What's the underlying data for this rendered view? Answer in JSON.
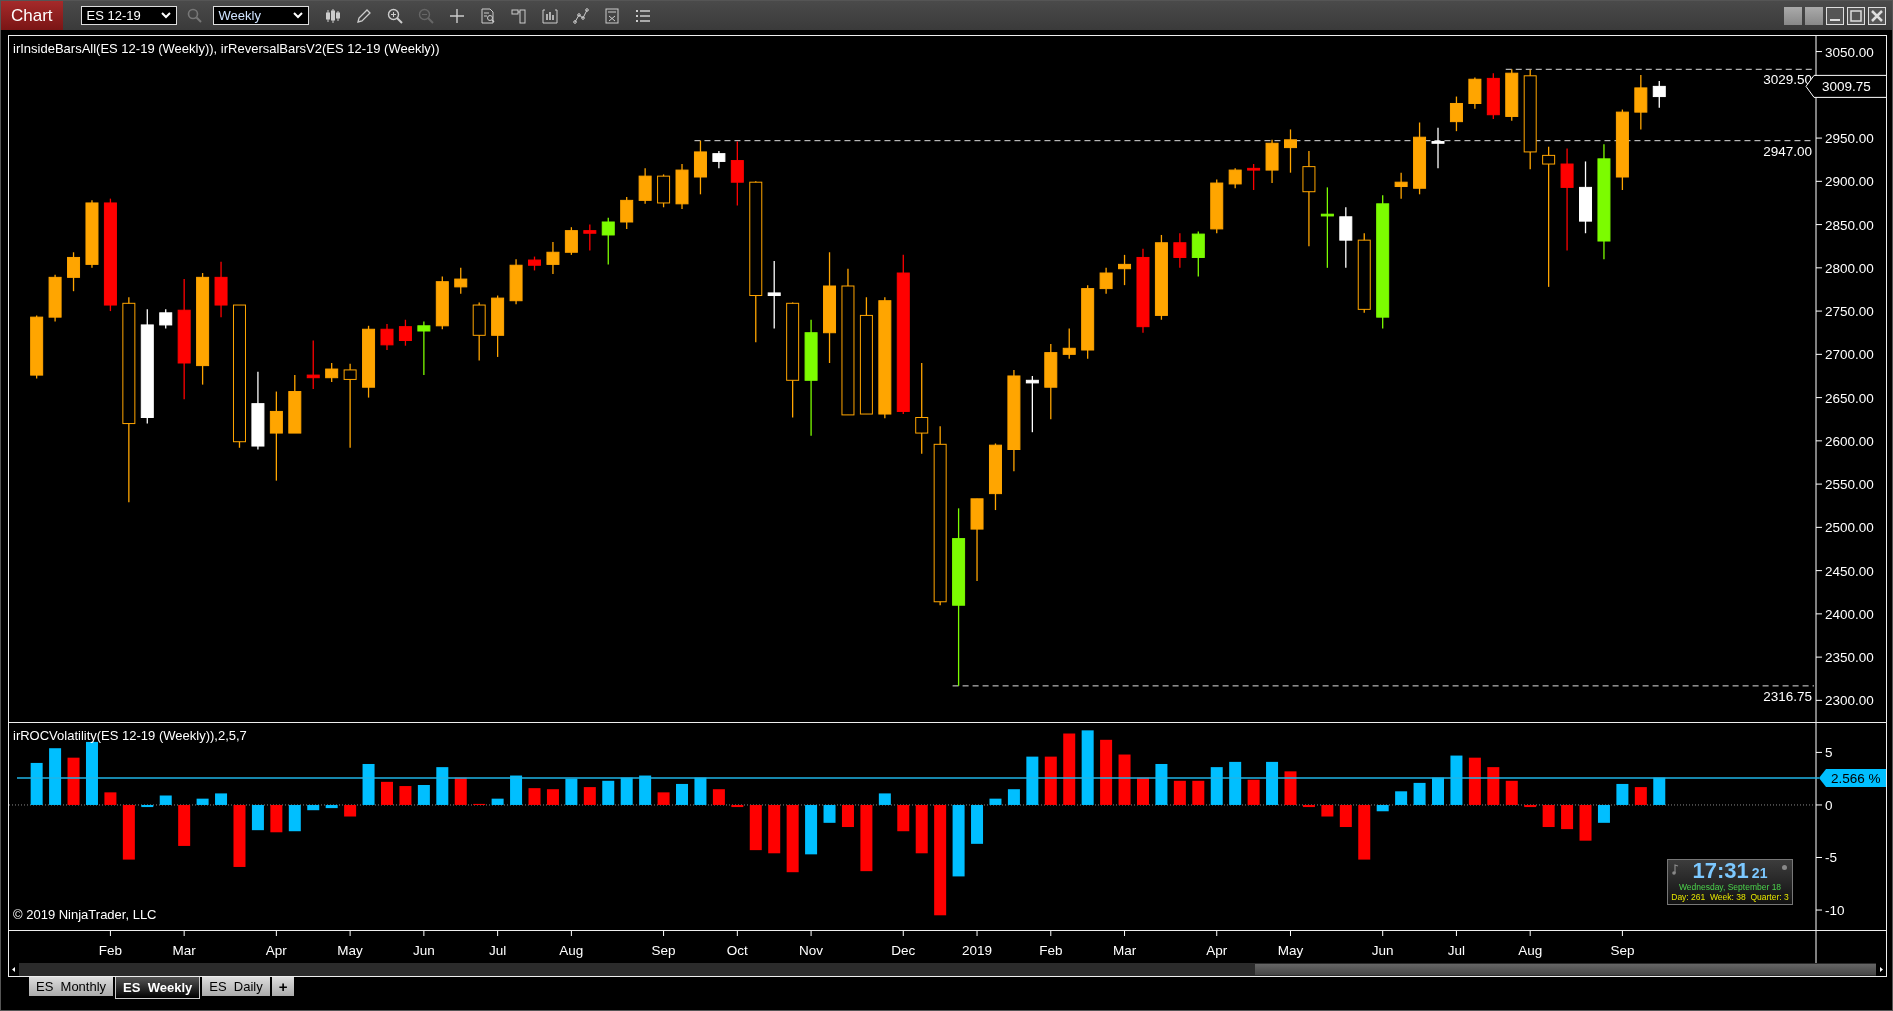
{
  "toolbar": {
    "title": "Chart",
    "instrument": "ES 12-19",
    "interval": "Weekly"
  },
  "price_chart": {
    "title": "irInsideBarsAll(ES 12-19 (Weekly)), irReversalBarsV2(ES 12-19 (Weekly))",
    "chart_data": {
      "type": "candlestick",
      "ylim": [
        2275,
        3068
      ],
      "categories": [
        null,
        null,
        null,
        null,
        null,
        null,
        null,
        null,
        null,
        null,
        null,
        null,
        null,
        null,
        null,
        null,
        null,
        null,
        null,
        null,
        null,
        null,
        null,
        null,
        null,
        null,
        null,
        null,
        null,
        null,
        null,
        null,
        null,
        null,
        null,
        null,
        null,
        null,
        null,
        null,
        null,
        null,
        null,
        null,
        null,
        null,
        null,
        null,
        null,
        null,
        null,
        null,
        null,
        null,
        null,
        null,
        null,
        null,
        null,
        null,
        null,
        null,
        null,
        null,
        null,
        null,
        null,
        null,
        null,
        null,
        null,
        null,
        null,
        null,
        null,
        null,
        null,
        null,
        null,
        null,
        null,
        null,
        null,
        null,
        null,
        null,
        null,
        null,
        null,
        null,
        null,
        null,
        null,
        null,
        null,
        null,
        null,
        null
      ],
      "yticks": [
        {
          "value": 3050,
          "label": "3050.00"
        },
        {
          "value": 2950,
          "label": "2950.00"
        },
        {
          "value": 2900,
          "label": "2900.00"
        },
        {
          "value": 2850,
          "label": "2850.00"
        },
        {
          "value": 2800,
          "label": "2800.00"
        },
        {
          "value": 2750,
          "label": "2750.00"
        },
        {
          "value": 2700,
          "label": "2700.00"
        },
        {
          "value": 2650,
          "label": "2650.00"
        },
        {
          "value": 2600,
          "label": "2600.00"
        },
        {
          "value": 2550,
          "label": "2550.00"
        },
        {
          "value": 2500,
          "label": "2500.00"
        },
        {
          "value": 2450,
          "label": "2450.00"
        },
        {
          "value": 2400,
          "label": "2400.00"
        },
        {
          "value": 2350,
          "label": "2350.00"
        },
        {
          "value": 2300,
          "label": "2300.00"
        }
      ],
      "ohlc": [
        null,
        [
          2676,
          2745,
          2672,
          2743
        ],
        [
          2743,
          2792,
          2738,
          2789
        ],
        [
          2789,
          2818,
          2773,
          2812
        ],
        [
          2804,
          2878,
          2800,
          2875
        ],
        [
          2875,
          2880,
          2750,
          2757
        ],
        [
          2759,
          2766,
          2529,
          2620
        ],
        [
          2627,
          2752,
          2620,
          2734
        ],
        [
          2734,
          2752,
          2730,
          2748
        ],
        [
          2751,
          2787,
          2648,
          2690
        ],
        [
          2687,
          2794,
          2665,
          2789
        ],
        [
          2789,
          2807,
          2743,
          2757
        ],
        [
          2757,
          2757,
          2592,
          2599
        ],
        [
          2594,
          2680,
          2590,
          2643
        ],
        [
          2609,
          2657,
          2554,
          2634
        ],
        [
          2609,
          2676,
          2609,
          2657
        ],
        [
          2676,
          2716,
          2660,
          2673
        ],
        [
          2673,
          2690,
          2668,
          2683
        ],
        [
          2682,
          2689,
          2592,
          2671
        ],
        [
          2662,
          2733,
          2650,
          2729
        ],
        [
          2729,
          2735,
          2705,
          2711
        ],
        [
          2732,
          2740,
          2710,
          2716
        ],
        [
          2727,
          2738,
          2676,
          2733
        ],
        [
          2733,
          2790,
          2729,
          2784
        ],
        [
          2778,
          2800,
          2770,
          2787
        ],
        [
          2757,
          2760,
          2693,
          2722
        ],
        [
          2722,
          2768,
          2697,
          2765
        ],
        [
          2762,
          2810,
          2758,
          2803
        ],
        [
          2809,
          2813,
          2797,
          2803
        ],
        [
          2804,
          2830,
          2793,
          2818
        ],
        [
          2818,
          2847,
          2815,
          2843
        ],
        [
          2843,
          2850,
          2820,
          2840
        ],
        [
          2838,
          2858,
          2804,
          2853
        ],
        [
          2853,
          2882,
          2845,
          2878
        ],
        [
          2878,
          2915,
          2874,
          2906
        ],
        [
          2906,
          2908,
          2870,
          2875
        ],
        [
          2874,
          2920,
          2868,
          2913
        ],
        [
          2905,
          2947,
          2885,
          2934
        ],
        [
          2923,
          2935,
          2915,
          2932
        ],
        [
          2924,
          2946,
          2872,
          2899
        ],
        [
          2899,
          2900,
          2714,
          2768
        ],
        [
          2771,
          2808,
          2730,
          2768
        ],
        [
          2759,
          2760,
          2627,
          2670
        ],
        [
          2670,
          2740,
          2606,
          2725
        ],
        [
          2725,
          2818,
          2690,
          2779
        ],
        [
          2779,
          2799,
          2630,
          2630
        ],
        [
          2745,
          2766,
          2631,
          2631
        ],
        [
          2631,
          2766,
          2626,
          2762
        ],
        [
          2794,
          2815,
          2631,
          2634
        ],
        [
          2627,
          2690,
          2585,
          2609
        ],
        [
          2596,
          2617,
          2410,
          2414
        ],
        [
          2410,
          2522,
          2316.75,
          2487
        ],
        [
          2498,
          2533,
          2438,
          2533
        ],
        [
          2539,
          2597,
          2520,
          2595
        ],
        [
          2590,
          2682,
          2565,
          2675
        ],
        [
          2667,
          2675,
          2610,
          2670
        ],
        [
          2662,
          2712,
          2625,
          2702
        ],
        [
          2700,
          2730,
          2695,
          2707
        ],
        [
          2705,
          2780,
          2695,
          2776
        ],
        [
          2776,
          2800,
          2770,
          2794
        ],
        [
          2799,
          2815,
          2780,
          2804
        ],
        [
          2812,
          2822,
          2725,
          2732
        ],
        [
          2745,
          2838,
          2740,
          2829
        ],
        [
          2829,
          2840,
          2800,
          2812
        ],
        [
          2812,
          2842,
          2790,
          2839
        ],
        [
          2845,
          2902,
          2840,
          2898
        ],
        [
          2897,
          2915,
          2892,
          2913
        ],
        [
          2915,
          2920,
          2890,
          2913
        ],
        [
          2913,
          2948,
          2898,
          2944
        ],
        [
          2939,
          2960,
          2910,
          2948
        ],
        [
          2917,
          2935,
          2825,
          2888
        ],
        [
          2860,
          2893,
          2800,
          2862
        ],
        [
          2859,
          2870,
          2800,
          2832
        ],
        [
          2832,
          2840,
          2748,
          2752
        ],
        [
          2743,
          2884,
          2730,
          2874
        ],
        [
          2894,
          2910,
          2880,
          2899
        ],
        [
          2892,
          2968,
          2885,
          2951
        ],
        [
          2944,
          2962,
          2915,
          2946
        ],
        [
          2969,
          2998,
          2958,
          2990
        ],
        [
          2990,
          3020,
          2984,
          3018
        ],
        [
          3019,
          3025,
          2972,
          2977
        ],
        [
          2975,
          3029.5,
          2970,
          3025
        ],
        [
          3022,
          3029,
          2914,
          2934
        ],
        [
          2930,
          2940,
          2778,
          2920
        ],
        [
          2920,
          2938,
          2820,
          2893
        ],
        [
          2893,
          2923,
          2840,
          2854
        ],
        [
          2831,
          2943,
          2810,
          2926
        ],
        [
          2905,
          2983,
          2890,
          2980
        ],
        [
          2980,
          3023,
          2960,
          3008
        ],
        [
          2998,
          3016,
          2985,
          3009.75
        ],
        null,
        null,
        null,
        null,
        null,
        null,
        null,
        null
      ],
      "colors": [
        null,
        "#ffa500",
        "#ffa500",
        "#ffa500",
        "#ffa500",
        "#ff0000",
        "#ffa500",
        "#ffffff",
        "#ffffff",
        "#ff0000",
        "#ffa500",
        "#ff0000",
        "#ffa500",
        "#ffffff",
        "#ffa500",
        "#ffa500",
        "#ff0000",
        "#ffa500",
        "#ffa500",
        "#ffa500",
        "#ff0000",
        "#ff0000",
        "#7cfc00",
        "#ffa500",
        "#ffa500",
        "#ffa500",
        "#ffa500",
        "#ffa500",
        "#ff0000",
        "#ffa500",
        "#ffa500",
        "#ff0000",
        "#7cfc00",
        "#ffa500",
        "#ffa500",
        "#ffa500",
        "#ffa500",
        "#ffa500",
        "#ffffff",
        "#ff0000",
        "#ffa500",
        "#ffffff",
        "#ffa500",
        "#7cfc00",
        "#ffa500",
        "#ffa500",
        "#ffa500",
        "#ffa500",
        "#ff0000",
        "#ffa500",
        "#ffa500",
        "#7cfc00",
        "#ffa500",
        "#ffa500",
        "#ffa500",
        "#ffffff",
        "#ffa500",
        "#ffa500",
        "#ffa500",
        "#ffa500",
        "#ffa500",
        "#ff0000",
        "#ffa500",
        "#ff0000",
        "#7cfc00",
        "#ffa500",
        "#ffa500",
        "#ff0000",
        "#ffa500",
        "#ffa500",
        "#ffa500",
        "#7cfc00",
        "#ffffff",
        "#ffa500",
        "#7cfc00",
        "#ffa500",
        "#ffa500",
        "#ffffff",
        "#ffa500",
        "#ffa500",
        "#ff0000",
        "#ffa500",
        "#ffa500",
        "#ffa500",
        "#ff0000",
        "#ffffff",
        "#7cfc00",
        "#ffa500",
        "#ffa500",
        "#ffffff",
        null,
        null,
        null,
        null,
        null,
        null,
        null,
        null
      ],
      "annotations": [
        {
          "text": "3009.75"
        }
      ],
      "ref_lines": [
        {
          "axis": "y",
          "value": 3029.5,
          "label": "3029.50"
        },
        {
          "axis": "y",
          "value": 2947,
          "label": "2947.00"
        },
        {
          "axis": "y",
          "value": 2316.75,
          "label": "2316.75"
        }
      ]
    },
    "candles": [
      {
        "hollow": false
      },
      {
        "hollow": false
      },
      {
        "hollow": false
      },
      {
        "hollow": false
      },
      {
        "hollow": false
      },
      {
        "hollow": true
      },
      {
        "hollow": false
      },
      {
        "hollow": false
      },
      {
        "hollow": false
      },
      {
        "hollow": false
      },
      {
        "hollow": false
      },
      {
        "hollow": true
      },
      {
        "hollow": false
      },
      {
        "hollow": false
      },
      {
        "hollow": false
      },
      {
        "hollow": false
      },
      {
        "hollow": false
      },
      {
        "hollow": true
      },
      {
        "hollow": false
      },
      {
        "hollow": false
      },
      {
        "hollow": false
      },
      {
        "hollow": false
      },
      {
        "hollow": false
      },
      {
        "hollow": false
      },
      {
        "hollow": true
      },
      {
        "hollow": false
      },
      {
        "hollow": false
      },
      {
        "hollow": false
      },
      {
        "hollow": false
      },
      {
        "hollow": false
      },
      {
        "hollow": false
      },
      {
        "hollow": false
      },
      {
        "hollow": false
      },
      {
        "hollow": false
      },
      {
        "hollow": true
      },
      {
        "hollow": false
      },
      {
        "hollow": false
      },
      {
        "hollow": false
      },
      {
        "hollow": false
      },
      {
        "hollow": true
      },
      {
        "hollow": false
      },
      {
        "hollow": true
      },
      {
        "hollow": false
      },
      {
        "hollow": false
      },
      {
        "hollow": true
      },
      {
        "hollow": true
      },
      {
        "hollow": false
      },
      {
        "hollow": false
      },
      {
        "hollow": true
      },
      {
        "hollow": true
      },
      {
        "hollow": false
      },
      {
        "hollow": false
      },
      {
        "hollow": false
      },
      {
        "hollow": false
      },
      {
        "hollow": false
      },
      {
        "hollow": false
      },
      {
        "hollow": false
      },
      {
        "hollow": false
      },
      {
        "hollow": false
      },
      {
        "hollow": false
      },
      {
        "hollow": false
      },
      {
        "hollow": false
      },
      {
        "hollow": false
      },
      {
        "hollow": false
      },
      {
        "hollow": false
      },
      {
        "hollow": false
      },
      {
        "hollow": false
      },
      {
        "hollow": false
      },
      {
        "hollow": false
      },
      {
        "hollow": true
      },
      {
        "hollow": false
      },
      {
        "hollow": false
      },
      {
        "hollow": true
      },
      {
        "hollow": false
      },
      {
        "hollow": false
      },
      {
        "hollow": false
      },
      {
        "hollow": false
      },
      {
        "hollow": false
      },
      {
        "hollow": false
      },
      {
        "hollow": false
      },
      {
        "hollow": false
      },
      {
        "hollow": true
      },
      {
        "hollow": true
      },
      {
        "hollow": false
      },
      {
        "hollow": false
      },
      {
        "hollow": false
      },
      {
        "hollow": false
      },
      {
        "hollow": false
      },
      {
        "hollow": false
      }
    ]
  },
  "indicator_chart": {
    "title": "irROCVolatility(ES 12-19 (Weekly)),2,5,7",
    "chart_data": {
      "type": "bar",
      "ylim": [
        -11.9,
        7.8
      ],
      "categories": [
        null,
        null,
        null,
        null,
        null,
        "Feb",
        null,
        null,
        null,
        "Mar",
        null,
        null,
        null,
        null,
        "Apr",
        null,
        null,
        null,
        "May",
        null,
        null,
        null,
        "Jun",
        null,
        null,
        null,
        "Jul",
        null,
        null,
        null,
        "Aug",
        null,
        null,
        null,
        null,
        "Sep",
        null,
        null,
        null,
        "Oct",
        null,
        null,
        null,
        "Nov",
        null,
        null,
        null,
        null,
        "Dec",
        null,
        null,
        null,
        "2019",
        null,
        null,
        null,
        "Feb",
        null,
        null,
        null,
        "Mar",
        null,
        null,
        null,
        null,
        "Apr",
        null,
        null,
        null,
        "May",
        null,
        null,
        null,
        null,
        "Jun",
        null,
        null,
        null,
        "Jul",
        null,
        null,
        null,
        "Aug",
        null,
        null,
        null,
        null,
        "Sep",
        null,
        null,
        null,
        null,
        null,
        null,
        null,
        null,
        null,
        null
      ],
      "yticks": [
        {
          "value": 5,
          "label": "5"
        },
        {
          "value": 0,
          "label": "0"
        },
        {
          "value": -5,
          "label": "-5"
        },
        {
          "value": -10,
          "label": "-10"
        }
      ],
      "values": [
        null,
        4.0,
        5.4,
        4.5,
        6.0,
        1.2,
        -5.2,
        -0.2,
        0.9,
        -3.9,
        0.6,
        1.1,
        -5.9,
        -2.4,
        -2.6,
        -2.5,
        -0.5,
        -0.3,
        -1.1,
        3.9,
        2.2,
        1.8,
        1.9,
        3.6,
        2.6,
        0.1,
        0.6,
        2.8,
        1.6,
        1.5,
        2.5,
        1.7,
        2.3,
        2.6,
        2.8,
        1.2,
        2.0,
        2.6,
        1.5,
        -0.2,
        -4.3,
        -4.6,
        -6.4,
        -4.7,
        -1.7,
        -2.1,
        -6.3,
        1.1,
        -2.5,
        -4.6,
        -10.5,
        -6.8,
        -3.7,
        0.6,
        1.5,
        4.6,
        4.6,
        6.8,
        7.1,
        6.2,
        4.8,
        2.6,
        3.9,
        2.3,
        2.3,
        3.6,
        4.1,
        2.4,
        4.1,
        3.2,
        -0.2,
        -1.1,
        -2.1,
        -5.2,
        -0.6,
        1.3,
        2.1,
        2.6,
        4.7,
        4.5,
        3.6,
        2.3,
        -0.2,
        -2.1,
        -2.3,
        -3.4,
        -1.7,
        2.0,
        1.7,
        2.6,
        null,
        null,
        null,
        null,
        null,
        null,
        null,
        null
      ],
      "colors": [
        null,
        "#00bfff",
        "#00bfff",
        "#ff0000",
        "#00bfff",
        "#ff0000",
        "#ff0000",
        "#00bfff",
        "#00bfff",
        "#ff0000",
        "#00bfff",
        "#00bfff",
        "#ff0000",
        "#00bfff",
        "#ff0000",
        "#00bfff",
        "#00bfff",
        "#00bfff",
        "#ff0000",
        "#00bfff",
        "#ff0000",
        "#ff0000",
        "#00bfff",
        "#00bfff",
        "#ff0000",
        "#ff0000",
        "#00bfff",
        "#00bfff",
        "#ff0000",
        "#ff0000",
        "#00bfff",
        "#ff0000",
        "#00bfff",
        "#00bfff",
        "#00bfff",
        "#ff0000",
        "#00bfff",
        "#00bfff",
        "#ff0000",
        "#ff0000",
        "#ff0000",
        "#ff0000",
        "#ff0000",
        "#00bfff",
        "#00bfff",
        "#ff0000",
        "#ff0000",
        "#00bfff",
        "#ff0000",
        "#ff0000",
        "#ff0000",
        "#00bfff",
        "#00bfff",
        "#00bfff",
        "#00bfff",
        "#00bfff",
        "#ff0000",
        "#ff0000",
        "#00bfff",
        "#ff0000",
        "#ff0000",
        "#ff0000",
        "#00bfff",
        "#ff0000",
        "#ff0000",
        "#00bfff",
        "#00bfff",
        "#ff0000",
        "#00bfff",
        "#ff0000",
        "#ff0000",
        "#ff0000",
        "#ff0000",
        "#ff0000",
        "#00bfff",
        "#00bfff",
        "#00bfff",
        "#00bfff",
        "#00bfff",
        "#ff0000",
        "#ff0000",
        "#ff0000",
        "#ff0000",
        "#ff0000",
        "#ff0000",
        "#ff0000",
        "#00bfff",
        "#00bfff",
        "#ff0000",
        "#00bfff",
        null,
        null,
        null,
        null,
        null,
        null,
        null,
        null
      ],
      "ref_lines": [
        {
          "axis": "y",
          "value": 2.566,
          "label": "2.566 %"
        }
      ]
    },
    "copyright": "© 2019 NinjaTrader, LLC",
    "clock": {
      "time": "17:31",
      "seconds": "21",
      "date": "Wednesday, September 18",
      "info": "Day: 261  Week: 38  Quarter: 3"
    }
  },
  "tabs": [
    {
      "label": "ES  Monthly",
      "selected": false
    },
    {
      "label": "ES  Weekly",
      "selected": true
    },
    {
      "label": "ES  Daily",
      "selected": false
    }
  ],
  "add_tab": "+"
}
